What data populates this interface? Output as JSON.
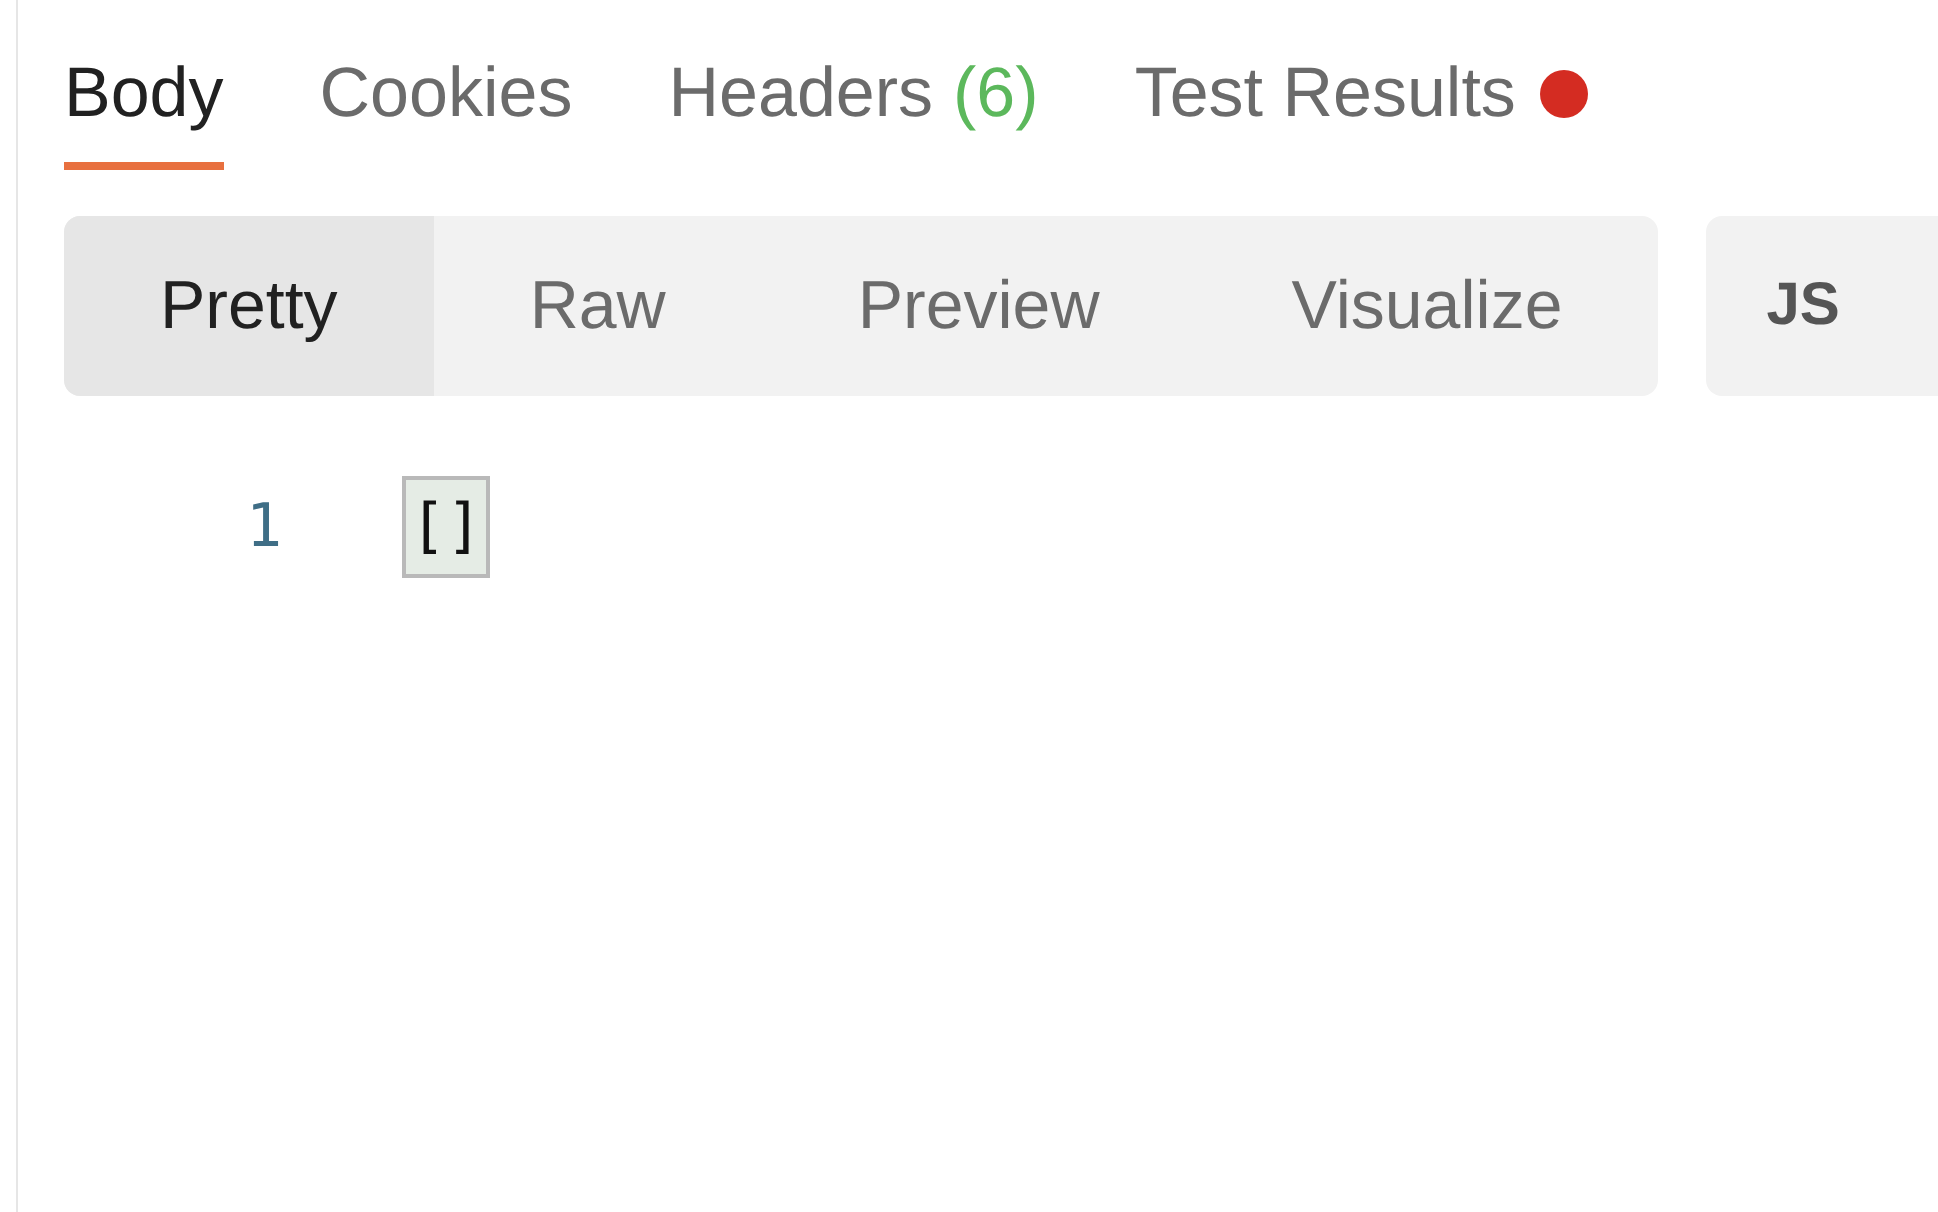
{
  "tabs": [
    {
      "label": "Body",
      "selected": true
    },
    {
      "label": "Cookies",
      "selected": false
    },
    {
      "label": "Headers",
      "count": "(6)",
      "selected": false
    },
    {
      "label": "Test Results",
      "alert": true,
      "selected": false
    }
  ],
  "view_modes": [
    {
      "label": "Pretty",
      "selected": true
    },
    {
      "label": "Raw",
      "selected": false
    },
    {
      "label": "Preview",
      "selected": false
    },
    {
      "label": "Visualize",
      "selected": false
    }
  ],
  "format_dropdown": {
    "value": "JS"
  },
  "editor": {
    "lines": [
      {
        "number": "1",
        "code": "[]",
        "highlighted": true
      }
    ]
  }
}
